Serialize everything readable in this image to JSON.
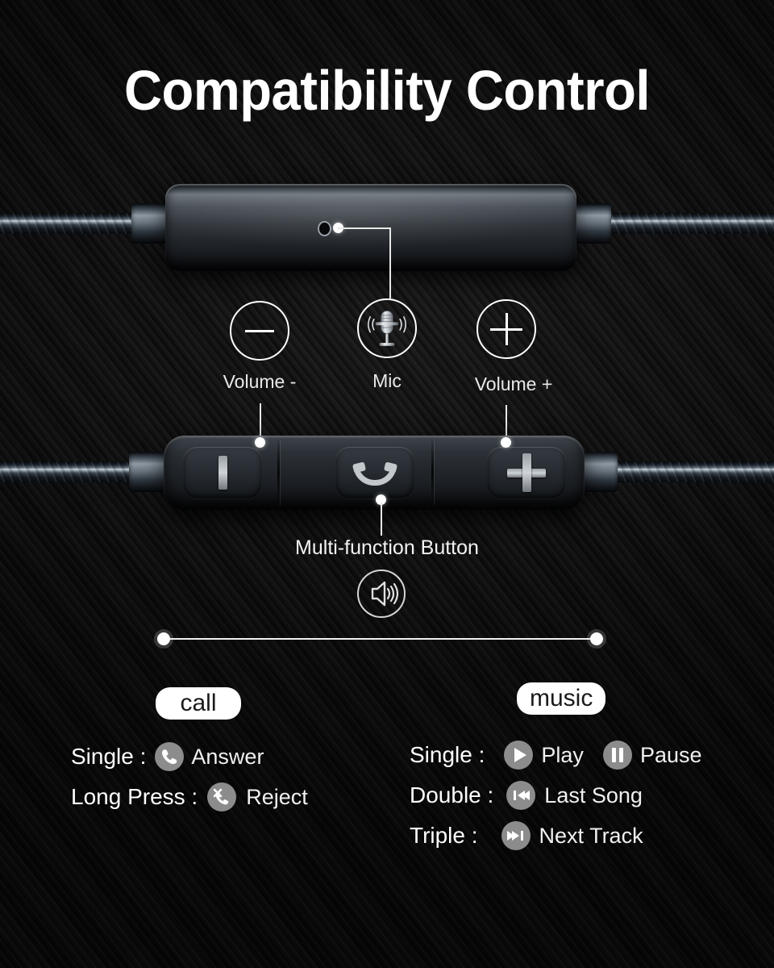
{
  "page": {
    "title": "Compatibility Control",
    "background_color": "#0a0a0a",
    "accent_color": "#ffffff"
  },
  "device": {
    "top_module": {
      "name": "inline-microphone-module",
      "mic_hole_icon": "mic-hole-icon"
    },
    "bottom_module": {
      "name": "inline-remote-module",
      "buttons": [
        {
          "id": "volume-down",
          "glyph": "minus-bar-icon"
        },
        {
          "id": "multi-function",
          "glyph": "phone-handset-icon"
        },
        {
          "id": "volume-up",
          "glyph": "plus-icon"
        }
      ]
    }
  },
  "controls": [
    {
      "label": "Volume -",
      "icon": "minus-icon"
    },
    {
      "label": "Mic",
      "icon": "microphone-icon"
    },
    {
      "label": "Volume +",
      "icon": "plus-icon"
    }
  ],
  "multifunction": {
    "label": "Multi-function Button",
    "icon": "speaker-volume-icon"
  },
  "sections": {
    "call": {
      "badge": "call",
      "rows": [
        {
          "key": "Single :",
          "icon": "phone-answer-icon",
          "value": "Answer"
        },
        {
          "key": "Long Press :",
          "icon": "phone-reject-icon",
          "value": "Reject"
        }
      ]
    },
    "music": {
      "badge": "music",
      "rows": [
        {
          "key": "Single :",
          "items": [
            {
              "icon": "play-icon",
              "value": "Play"
            },
            {
              "icon": "pause-icon",
              "value": "Pause"
            }
          ]
        },
        {
          "key": "Double :",
          "items": [
            {
              "icon": "previous-track-icon",
              "value": "Last Song"
            }
          ]
        },
        {
          "key": "Triple :",
          "items": [
            {
              "icon": "next-track-icon",
              "value": "Next Track"
            }
          ]
        }
      ]
    }
  }
}
